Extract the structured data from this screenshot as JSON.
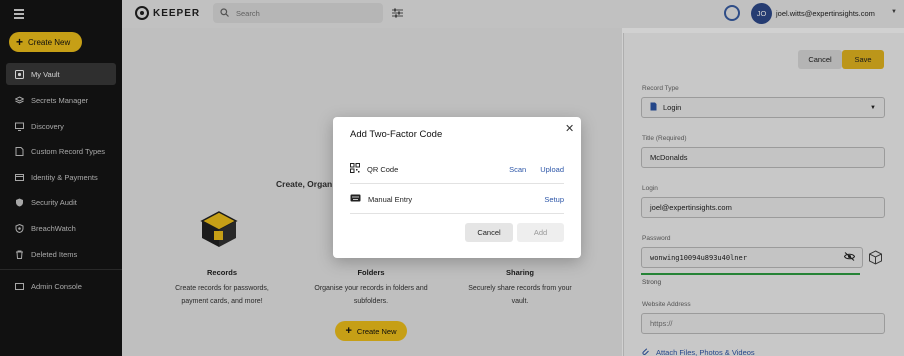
{
  "colors": {
    "accent": "#f2c21b",
    "sidebar": "#151515",
    "link": "#2d56a8",
    "strength": "#2ea043"
  },
  "sidebar": {
    "create_label": "Create New",
    "items": [
      {
        "label": "My Vault",
        "icon": "vault-icon"
      },
      {
        "label": "Secrets Manager",
        "icon": "layers-icon"
      },
      {
        "label": "Discovery",
        "icon": "monitor-icon"
      },
      {
        "label": "Custom Record Types",
        "icon": "record-types-icon"
      },
      {
        "label": "Identity & Payments",
        "icon": "card-icon"
      },
      {
        "label": "Security Audit",
        "icon": "shield-icon"
      },
      {
        "label": "BreachWatch",
        "icon": "breachwatch-icon"
      },
      {
        "label": "Deleted Items",
        "icon": "trash-icon"
      },
      {
        "label": "Admin Console",
        "icon": "console-icon"
      }
    ]
  },
  "header": {
    "logo_text": "KEEPER",
    "search_placeholder": "Search",
    "avatar_initials": "JO",
    "user_email": "joel.witts@expertinsights.com"
  },
  "main": {
    "title": "Create, Organ",
    "columns": [
      {
        "heading": "Records",
        "desc_line1": "Create records for passwords,",
        "desc_line2": "payment cards, and more!"
      },
      {
        "heading": "Folders",
        "desc_line1": "Organise your records in folders and",
        "desc_line2": "subfolders."
      },
      {
        "heading": "Sharing",
        "desc_line1": "Securely share records from your",
        "desc_line2": "vault."
      }
    ],
    "create_label": "Create New"
  },
  "panel": {
    "cancel_label": "Cancel",
    "save_label": "Save",
    "record_type_label": "Record Type",
    "record_type_value": "Login",
    "title_label": "Title (Required)",
    "title_value": "McDonalds",
    "login_label": "Login",
    "login_value": "joel@expertinsights.com",
    "password_label": "Password",
    "password_value": "wonwing10094u893u40lner",
    "strength_label": "Strong",
    "website_label": "Website Address",
    "website_placeholder": "https://",
    "attach_label": "Attach Files, Photos & Videos"
  },
  "modal": {
    "title": "Add Two-Factor Code",
    "qr_label": "QR Code",
    "scan_label": "Scan",
    "upload_label": "Upload",
    "manual_label": "Manual Entry",
    "setup_label": "Setup",
    "cancel_label": "Cancel",
    "add_label": "Add"
  }
}
